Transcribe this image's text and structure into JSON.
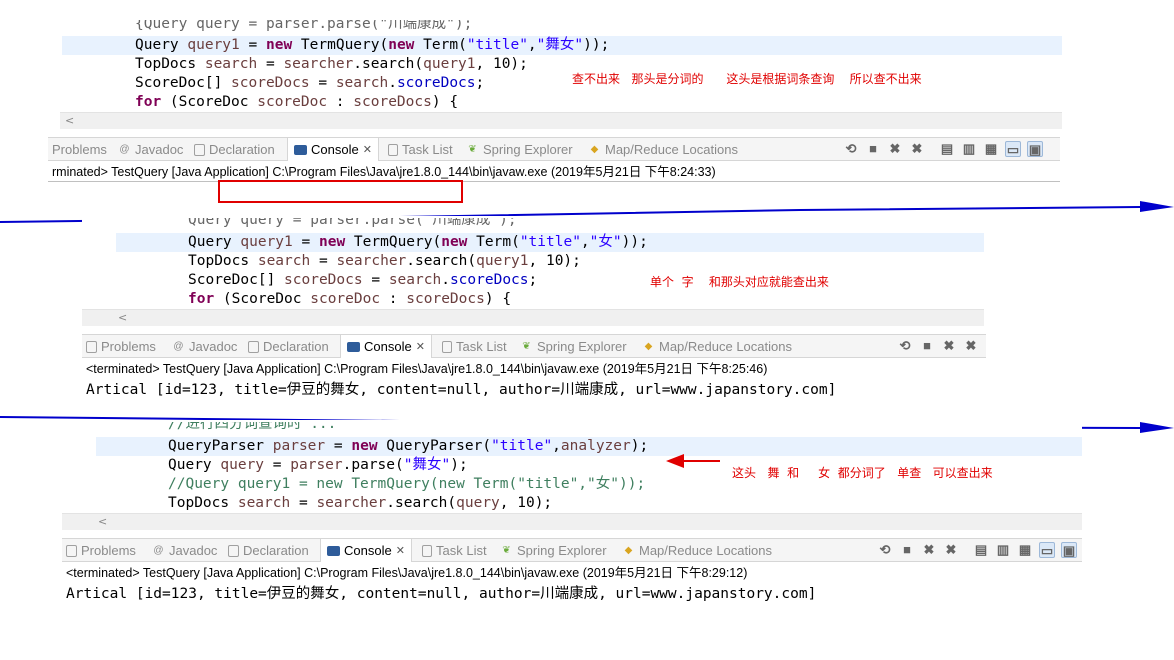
{
  "panel1": {
    "code": {
      "line0": "{Query query = parser.parse(\"川端康成\");",
      "line1": [
        "Query ",
        "query1",
        " = ",
        "new",
        " TermQuery(",
        "new",
        " Term(",
        "\"title\"",
        ",",
        "\"舞女\"",
        "));"
      ],
      "line2": [
        "TopDocs ",
        "search",
        " = ",
        "searcher",
        ".search(",
        "query1",
        ", 10);"
      ],
      "line3": [
        "ScoreDoc[] ",
        "scoreDocs",
        " = ",
        "search",
        ".",
        "scoreDocs",
        ";"
      ],
      "line4": [
        "for",
        " (ScoreDoc ",
        "scoreDoc",
        " : ",
        "scoreDocs",
        ") {"
      ]
    },
    "note": "查不出来   那头是分词的      这头是根据词条查询    所以查不出来",
    "status": "rminated> TestQuery [Java Application] C:\\Program Files\\Java\\jre1.8.0_144\\bin\\javaw.exe (2019年5月21日 下午8:24:33)"
  },
  "panel2": {
    "code": {
      "line1": [
        "Query ",
        "query1",
        " = ",
        "new",
        " TermQuery(",
        "new",
        " Term(",
        "\"title\"",
        ",",
        "\"女\"",
        "));"
      ],
      "line2": [
        "TopDocs ",
        "search",
        " = ",
        "searcher",
        ".search(",
        "query1",
        ", 10);"
      ],
      "line3": [
        "ScoreDoc[] ",
        "scoreDocs",
        " = ",
        "search",
        ".",
        "scoreDocs",
        ";"
      ],
      "line4": [
        "for",
        " (ScoreDoc ",
        "scoreDoc",
        " : ",
        "scoreDocs",
        ") {"
      ]
    },
    "note": "单个  字    和那头对应就能查出来",
    "status": "<terminated> TestQuery [Java Application] C:\\Program Files\\Java\\jre1.8.0_144\\bin\\javaw.exe (2019年5月21日 下午8:25:46)",
    "output": "Artical [id=123, title=伊豆的舞女, content=null, author=川端康成, url=www.japanstory.com]"
  },
  "panel3": {
    "code": {
      "line1": [
        "QueryParser ",
        "parser",
        " = ",
        "new",
        " QueryParser(",
        "\"title\"",
        ",",
        "analyzer",
        ");"
      ],
      "line2": [
        "Query ",
        "query",
        " = ",
        "parser",
        ".parse(",
        "\"舞女\"",
        ");"
      ],
      "line3": "//Query query1 = new TermQuery(new Term(\"title\",\"女\"));",
      "line4": [
        "TopDocs ",
        "search",
        " = ",
        "searcher",
        ".search(",
        "query",
        ", 10);"
      ]
    },
    "note": "这头   舞  和     女  都分词了   单查   可以查出来",
    "status": "<terminated> TestQuery [Java Application] C:\\Program Files\\Java\\jre1.8.0_144\\bin\\javaw.exe (2019年5月21日 下午8:29:12)",
    "output": "Artical [id=123, title=伊豆的舞女, content=null, author=川端康成, url=www.japanstory.com]"
  },
  "tabs": {
    "problems": "Problems",
    "javadoc": "Javadoc",
    "declaration": "Declaration",
    "console": "Console",
    "tasklist": "Task List",
    "spring": "Spring Explorer",
    "mapreduce": "Map/Reduce Locations"
  },
  "colors": {
    "keyword": "#7f0055",
    "string": "#2a00ff",
    "field": "#0000c0",
    "note": "#e00000",
    "arrow": "#0000cc",
    "highlight_box": "#e00000"
  },
  "icons": [
    "problems-icon",
    "javadoc-icon",
    "declaration-icon",
    "console-icon",
    "tasklist-icon",
    "spring-icon",
    "mapreduce-icon",
    "pin-icon",
    "stop-icon",
    "remove-icon",
    "remove-all-icon",
    "clear-icon",
    "scroll-lock-icon",
    "word-wrap-icon",
    "display-console-icon",
    "new-console-icon"
  ]
}
